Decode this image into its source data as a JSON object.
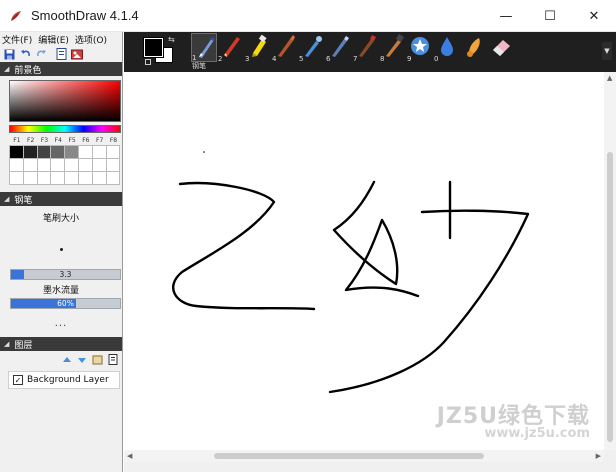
{
  "window": {
    "title": "SmoothDraw 4.1.4",
    "minimize": "—",
    "maximize": "☐",
    "close": "✕"
  },
  "menu": [
    "文件(F)",
    "编辑(E)",
    "选项(O)"
  ],
  "panels": {
    "foreground": {
      "title": "前景色"
    },
    "fkeys": [
      "F1",
      "F2",
      "F3",
      "F4",
      "F5",
      "F6",
      "F7",
      "F8"
    ],
    "swatches": [
      "#000000",
      "#222222",
      "#444444",
      "#666666",
      "#888888",
      "#ffffff",
      "#ffffff",
      "#ffffff",
      "#ffffff",
      "#ffffff",
      "#ffffff",
      "#ffffff",
      "#ffffff",
      "#ffffff",
      "#ffffff",
      "#ffffff",
      "#ffffff",
      "#ffffff",
      "#ffffff",
      "#ffffff",
      "#ffffff",
      "#ffffff",
      "#ffffff",
      "#ffffff"
    ],
    "brush": {
      "title": "钢笔",
      "size_label": "笔刷大小",
      "size_value": "3.3",
      "size_fraction": 0.12,
      "ink_label": "墨水流量",
      "ink_value": "60%",
      "ink_fraction": 0.6,
      "more": "..."
    },
    "layers": {
      "title": "图层",
      "items": [
        {
          "name": "Background Layer",
          "visible": true,
          "check": "✓"
        }
      ]
    }
  },
  "toolbar": {
    "selected_caption": "钢笔",
    "tools": [
      {
        "num": "1",
        "icon": "pen-icon"
      },
      {
        "num": "2",
        "icon": "pencil-icon"
      },
      {
        "num": "3",
        "icon": "highlighter-icon"
      },
      {
        "num": "4",
        "icon": "brush-icon"
      },
      {
        "num": "5",
        "icon": "airbrush-icon"
      },
      {
        "num": "6",
        "icon": "marker-icon"
      },
      {
        "num": "7",
        "icon": "oil-brush-icon"
      },
      {
        "num": "8",
        "icon": "flat-brush-icon"
      },
      {
        "num": "9",
        "icon": "star-brush-icon"
      },
      {
        "num": "0",
        "icon": "water-drop-icon"
      },
      {
        "num": "",
        "icon": "smudge-icon"
      },
      {
        "num": "",
        "icon": "eraser-icon"
      }
    ]
  },
  "watermark": {
    "main": "JZ5U绿色下载",
    "url": "www.jz5u.com"
  },
  "colors": {
    "accent": "#3b74d8",
    "toolbar_bg": "#1f1f1f",
    "section_bg": "#3a3a3a"
  }
}
